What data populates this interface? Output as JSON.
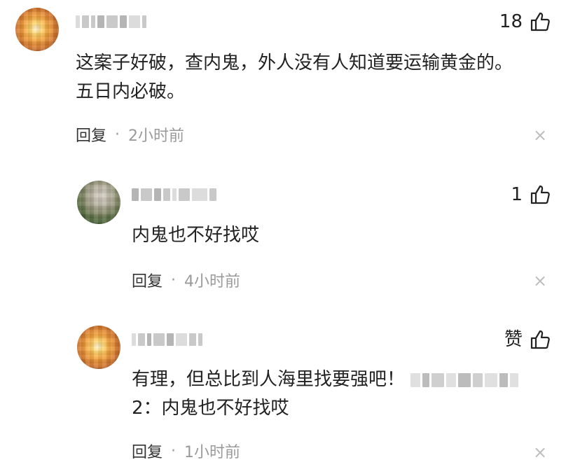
{
  "comments": [
    {
      "like_count": "18",
      "text": "这案子好破，查内鬼，外人没有人知道要运输黄金的。",
      "text_line2": "五日内必破。",
      "reply_label": "回复",
      "dot": "·",
      "time": "2小时前",
      "close": "×",
      "avatar": "sunset-avatar"
    },
    {
      "like_count": "1",
      "text": "内鬼也不好找哎",
      "reply_label": "回复",
      "dot": "·",
      "time": "4小时前",
      "close": "×",
      "avatar": "landscape-avatar"
    },
    {
      "like_label": "赞",
      "text": "有理，但总比到人海里找要强吧！",
      "text_line2": "2：内鬼也不好找哎",
      "reply_label": "回复",
      "dot": "·",
      "time": "1小时前",
      "close": "×",
      "avatar": "sunset-avatar"
    }
  ],
  "icons": {
    "like": "thumbs-up-icon",
    "close": "close-icon"
  },
  "colors": {
    "text": "#222222",
    "meta": "#9a9a9a",
    "close": "#bdbdbd"
  }
}
